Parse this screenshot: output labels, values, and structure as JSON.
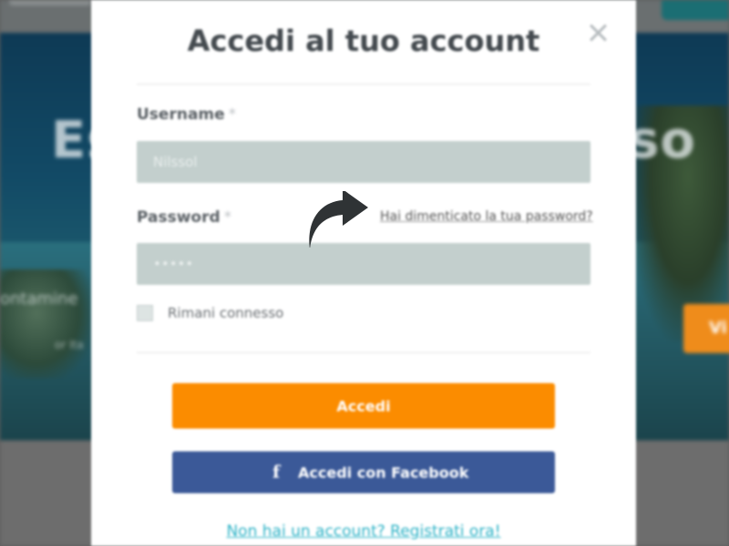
{
  "background": {
    "hero_title_left": "Es",
    "hero_title_right": "so",
    "hero_subtitle": "ontamine",
    "hero_subtitle_small": "or Ita",
    "side_button": "Vi"
  },
  "modal": {
    "title": "Accedi al tuo account",
    "username": {
      "label": "Username",
      "required_mark": "*",
      "placeholder": "Nilssol"
    },
    "password": {
      "label": "Password",
      "required_mark": "*",
      "placeholder": "•••••"
    },
    "forgot_password": "Hai dimenticato la tua password?",
    "remember_me": "Rimani connesso",
    "login_button": "Accedi",
    "facebook_button": "Accedi con Facebook",
    "facebook_icon": "f",
    "register_link": "Non hai un account? Registrati ora!"
  },
  "icons": {
    "close": "close-icon",
    "arrow": "curved-arrow-icon",
    "facebook": "facebook-icon"
  },
  "colors": {
    "login_button": "#fb8c00",
    "facebook_button": "#3b5998",
    "input_background": "#c3cfcd",
    "register_link": "#2bb2c6"
  }
}
